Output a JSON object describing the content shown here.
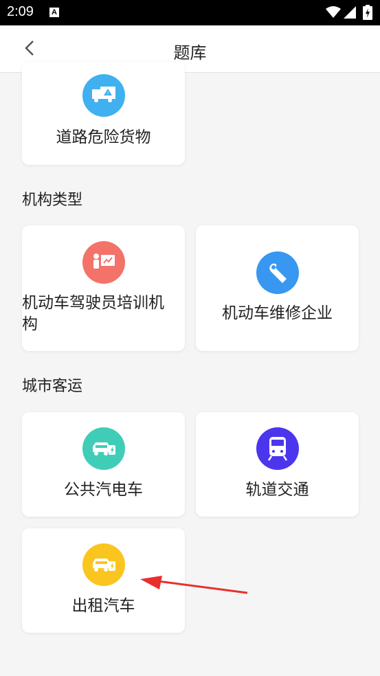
{
  "status_bar": {
    "time": "2:09",
    "a_icon": "A"
  },
  "header": {
    "title": "题库",
    "back_icon": "chevron-left-icon"
  },
  "sections": [
    {
      "title": "",
      "items": [
        {
          "label": "道路危险货物",
          "icon": "hazard-truck-icon",
          "color": "#3fb0f0"
        }
      ]
    },
    {
      "title": "机构类型",
      "items": [
        {
          "label": "机动车驾驶员培训机构",
          "icon": "instructor-icon",
          "color": "#f3726a"
        },
        {
          "label": "机动车维修企业",
          "icon": "wrench-icon",
          "color": "#3897f0"
        }
      ]
    },
    {
      "title": "城市客运",
      "items": [
        {
          "label": "公共汽电车",
          "icon": "electric-car-icon",
          "color": "#3fcdb8"
        },
        {
          "label": "轨道交通",
          "icon": "train-icon",
          "color": "#4b36ee"
        },
        {
          "label": "出租汽车",
          "icon": "electric-car-icon",
          "color": "#fbc51f"
        }
      ]
    }
  ],
  "annotation": {
    "arrow_color": "#e8302c"
  }
}
